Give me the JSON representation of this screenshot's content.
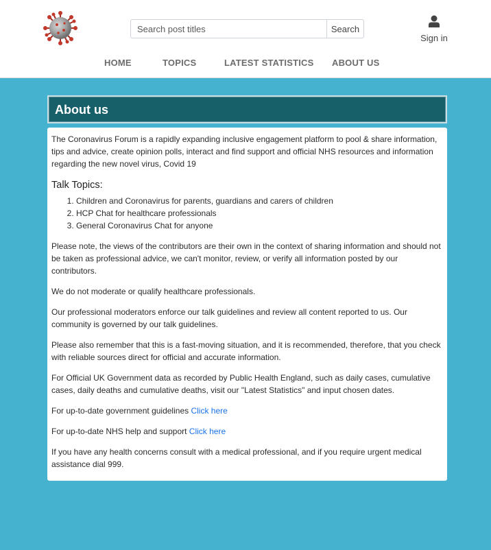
{
  "header": {
    "logo_icon": "coronavirus-logo-icon",
    "search": {
      "placeholder": "Search post titles",
      "value": "",
      "button_label": "Search"
    },
    "signin": {
      "icon": "user-icon",
      "label": "Sign in"
    }
  },
  "nav": {
    "items": [
      {
        "label": "HOME"
      },
      {
        "label": "TOPICS"
      },
      {
        "label": "LATEST STATISTICS"
      },
      {
        "label": "ABOUT US"
      }
    ]
  },
  "page": {
    "title": "About us",
    "intro": "The Coronavirus Forum is a rapidly expanding inclusive engagement platform to pool & share information, tips and advice, create opinion polls, interact and find support and official NHS resources and information regarding the new novel virus, Covid 19",
    "topics_heading": "Talk Topics:",
    "topics": [
      "Children and Coronavirus for parents, guardians and carers of children",
      "HCP Chat for healthcare professionals",
      "General Coronavirus Chat for anyone"
    ],
    "note": "Please note, the views of the contributors are their own in the context of sharing information and should not be taken as professional advice, we can't monitor, review, or verify all information posted by our contributors.",
    "moderation": "We do not moderate or qualify healthcare professionals.",
    "moderators": "Our professional moderators enforce our talk guidelines and review all content reported to us. Our community is governed by our talk guidelines.",
    "fast_moving": "Please also remember that this is a fast-moving situation, and it is recommended, therefore, that you check with reliable sources direct for official and accurate information.",
    "official_data": "For Official UK Government data as recorded by Public Health England, such as daily cases, cumulative cases, daily deaths and cumulative deaths, visit our \"Latest Statistics\" and input chosen dates.",
    "gov_guidelines_text": "For up-to-date government guidelines ",
    "gov_guidelines_link": "Click here",
    "nhs_help_text": "For up-to-date NHS help and support ",
    "nhs_help_link": "Click here",
    "concerns": "If you have any health concerns consult with a medical professional, and if you require urgent medical assistance dial 999."
  },
  "colors": {
    "background": "#45b2cf",
    "title_bar": "#17606a",
    "link": "#1a73e8",
    "nav_text": "#6c6c6c"
  }
}
